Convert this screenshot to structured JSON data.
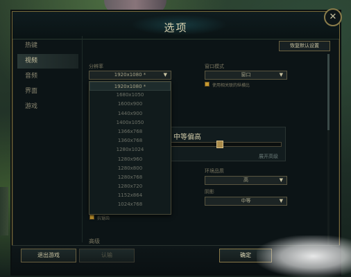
{
  "dialog": {
    "title": "选项",
    "close_glyph": "✕"
  },
  "sidebar": {
    "items": [
      {
        "label": "热键",
        "active": false
      },
      {
        "label": "视频",
        "active": true
      },
      {
        "label": "音频",
        "active": false
      },
      {
        "label": "界面",
        "active": false
      },
      {
        "label": "游戏",
        "active": false
      }
    ]
  },
  "header": {
    "restore_label": "恢复默认设置"
  },
  "video": {
    "resolution_label": "分辨率",
    "resolution_value": "1920x1080 *",
    "window_mode_label": "窗口模式",
    "window_mode_value": "窗口",
    "window_mode_check_label": "使用相关联的纵横比",
    "quality_value": "中等偏高",
    "advanced_label": "展开高级",
    "env_quality_label": "环境品质",
    "env_quality_value": "高",
    "shadow_label": "阴影",
    "shadow_value": "中等",
    "anti_alias_label": "抗锯齿",
    "section_cut_label": "高级"
  },
  "resolution_options": [
    "1920x1080 *",
    "1680x1050",
    "1600x900",
    "1440x900",
    "1400x1050",
    "1366x768",
    "1360x768",
    "1280x1024",
    "1280x960",
    "1280x800",
    "1280x768",
    "1280x720",
    "1152x864",
    "1024x768"
  ],
  "quality_slider": {
    "level": 0.45
  },
  "footer": {
    "exit_label": "退出游戏",
    "cancel_label": "认输",
    "confirm_label": "确定"
  },
  "colors": {
    "accent_gold": "#c89a30",
    "frame_gold": "#786a3a",
    "panel_bg": "#0c1416"
  }
}
